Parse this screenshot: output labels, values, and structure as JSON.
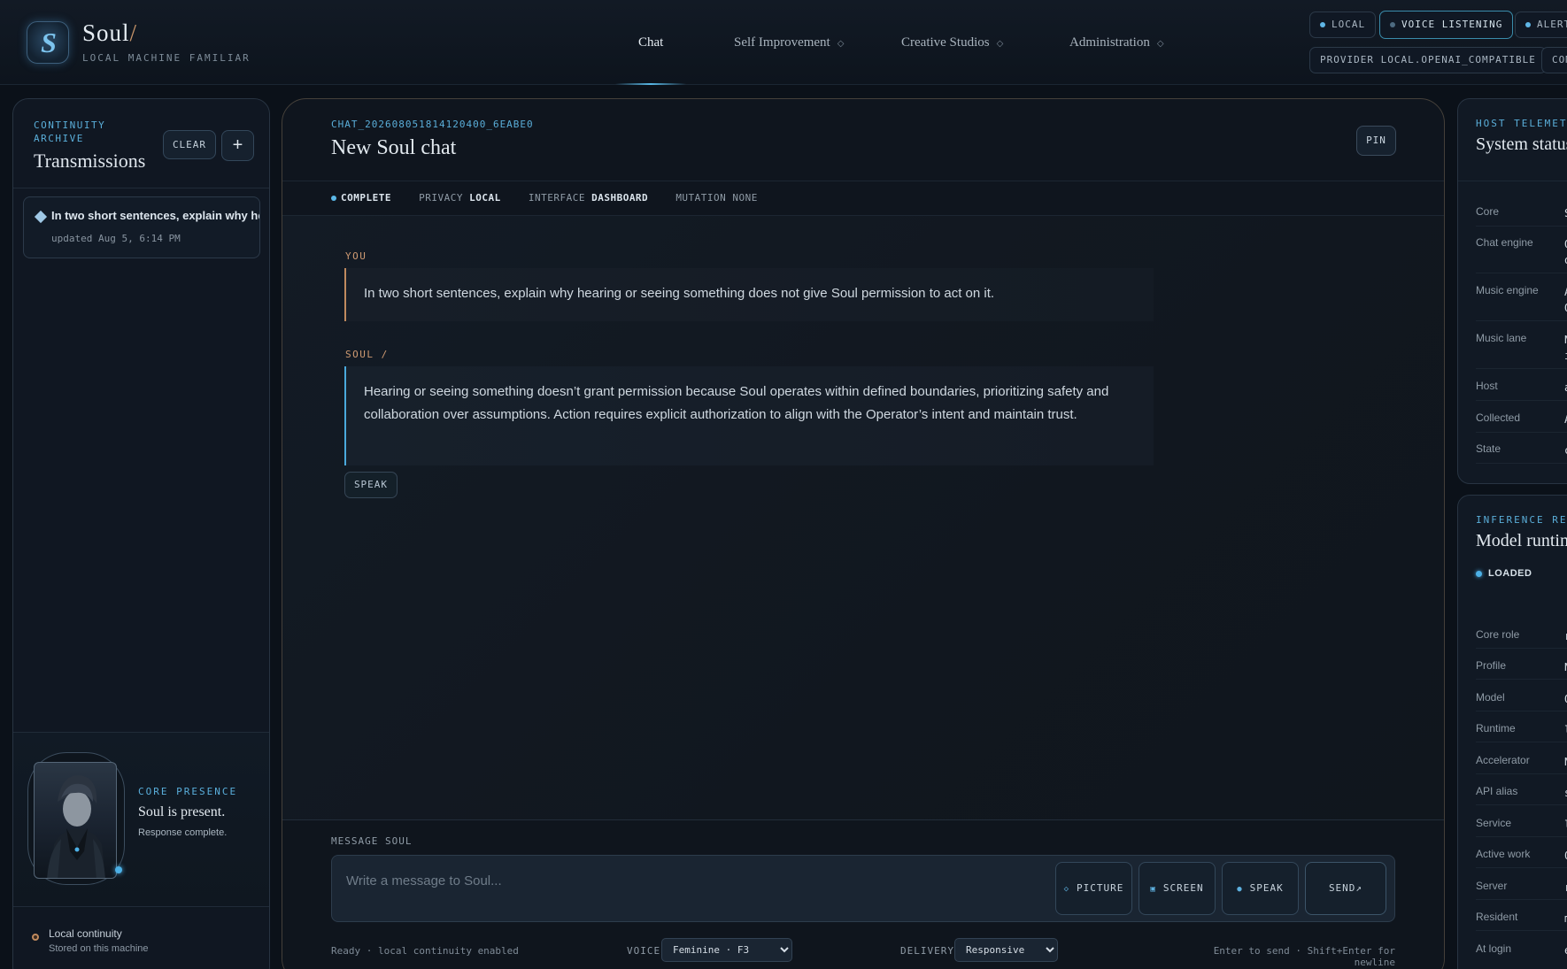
{
  "brand": {
    "name": "Soul",
    "slash": "/",
    "subtitle": "LOCAL MACHINE FAMILIAR"
  },
  "nav": {
    "chat": "Chat",
    "self_improvement": "Self Improvement",
    "creative_studios": "Creative Studios",
    "administration": "Administration"
  },
  "status_pills": {
    "local": "LOCAL",
    "voice": "VOICE LISTENING",
    "alerts": "ALERTS",
    "provider": "PROVIDER LOCAL.OPENAI_COMPATIBLE",
    "truncated": "COM"
  },
  "archive": {
    "label": "CONTINUITY ARCHIVE",
    "title": "Transmissions",
    "clear_label": "CLEAR",
    "add_label": "+",
    "threads": [
      {
        "title": "In two short sentences, explain why hearing or seeing something does not give Soul permission to act on it.",
        "updated": "updated Aug 5, 6:14 PM"
      }
    ]
  },
  "presence": {
    "label": "CORE PRESENCE",
    "title": "Soul is present.",
    "subtitle": "Response complete."
  },
  "continuity": {
    "title": "Local continuity",
    "subtitle": "Stored on this machine"
  },
  "chat": {
    "id": "CHAT_20260805181412040​0_6EABE0",
    "title": "New Soul chat",
    "pin_label": "PIN",
    "meta": {
      "status": "COMPLETE",
      "privacy_key": "PRIVACY",
      "privacy_value": "LOCAL",
      "interface_key": "INTERFACE",
      "interface_value": "DASHBOARD",
      "mutation_key": "MUTATION",
      "mutation_value": "NONE"
    },
    "messages": [
      {
        "role": "YOU",
        "text": "In two short sentences, explain why hearing or seeing something does not give Soul permission to act on it."
      },
      {
        "role": "SOUL /",
        "text": "Hearing or seeing something doesn’t grant permission because Soul operates within defined boundaries, prioritizing safety and collaboration over assumptions. Action requires explicit authorization to align with the Operator’s intent and maintain trust."
      }
    ],
    "speak_label": "SPEAK"
  },
  "composer": {
    "label": "MESSAGE SOUL",
    "placeholder": "Write a message to Soul...",
    "picture_label": "PICTURE",
    "screen_label": "SCREEN",
    "speak_label": "SPEAK",
    "send_label": "SEND↗",
    "status": "Ready · local continuity enabled",
    "voice_label": "VOICE",
    "voice_value": "Feminine · F3",
    "delivery_label": "DELIVERY",
    "delivery_value": "Responsive",
    "hint": "Enter to send · Shift+Enter for newline"
  },
  "telemetry": {
    "label": "HOST TELEMETRY",
    "title": "System status",
    "rows": [
      {
        "key": "Core",
        "value": "S"
      },
      {
        "key": "Chat engine",
        "value": "Q\no"
      },
      {
        "key": "Music engine",
        "value": "A\nQ"
      },
      {
        "key": "Music lane",
        "value": "N\ni"
      },
      {
        "key": "Host",
        "value": "a"
      },
      {
        "key": "Collected",
        "value": "A"
      },
      {
        "key": "State",
        "value": "c"
      }
    ]
  },
  "runtime": {
    "label": "INFERENCE RESIDENCY",
    "title": "Model runtime",
    "status": "LOADED",
    "rows": [
      {
        "key": "Core role",
        "value": "r"
      },
      {
        "key": "Profile",
        "value": "N"
      },
      {
        "key": "Model",
        "value": "Q"
      },
      {
        "key": "Runtime",
        "value": "l"
      },
      {
        "key": "Accelerator",
        "value": "N"
      },
      {
        "key": "API alias",
        "value": "s"
      },
      {
        "key": "Service",
        "value": "l"
      },
      {
        "key": "Active work",
        "value": "0"
      },
      {
        "key": "Server",
        "value": "r"
      },
      {
        "key": "Resident",
        "value": "m"
      },
      {
        "key": "At login",
        "value": "e"
      }
    ]
  }
}
